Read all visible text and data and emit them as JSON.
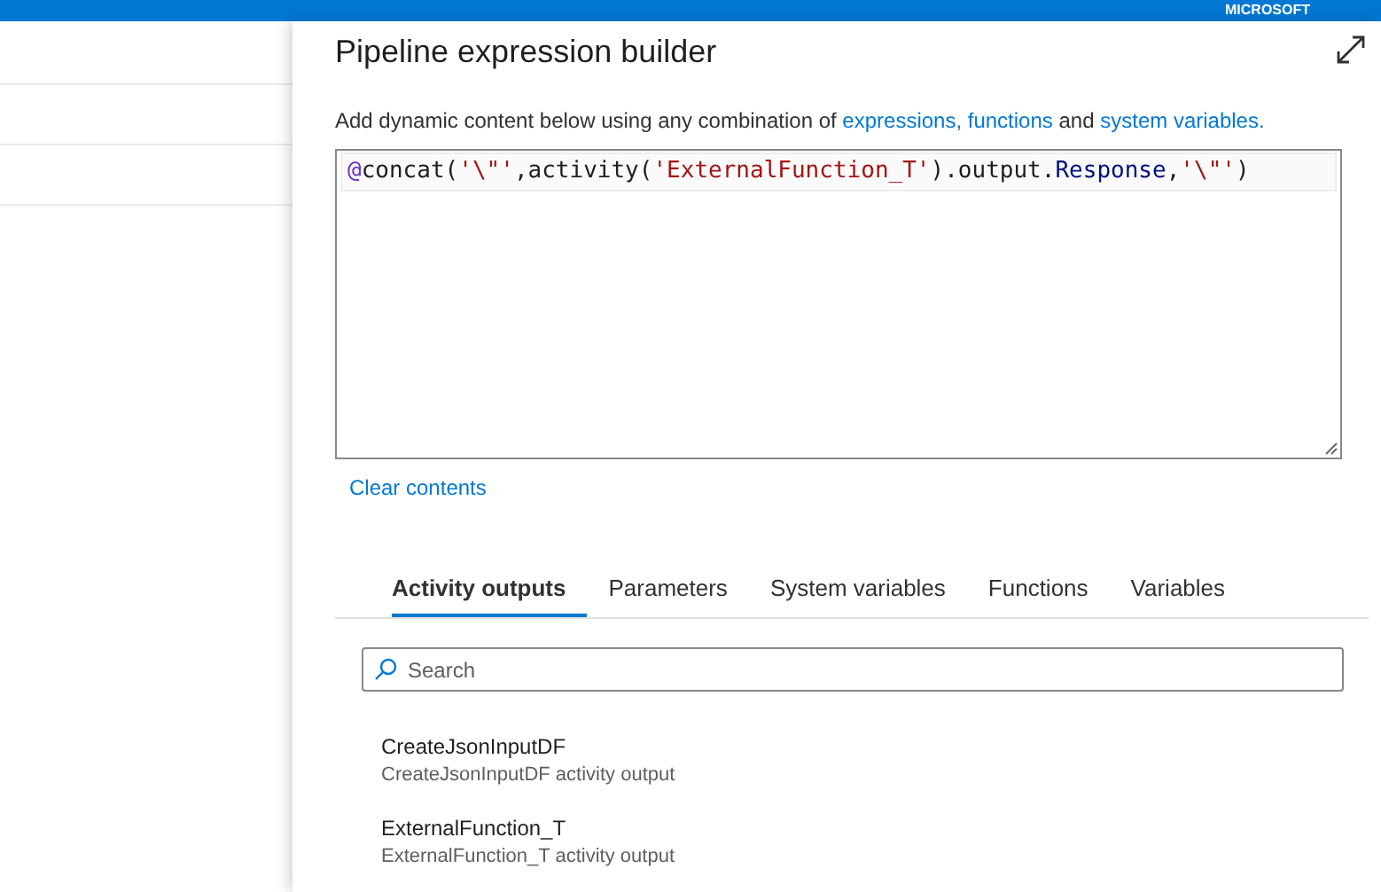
{
  "top_bar": {
    "brand": "MICROSOFT"
  },
  "panel": {
    "title": "Pipeline expression builder",
    "description": [
      {
        "kind": "text",
        "text": "Add dynamic content below using any combination of "
      },
      {
        "kind": "link",
        "text": "expressions, functions"
      },
      {
        "kind": "text",
        "text": " and "
      },
      {
        "kind": "link",
        "text": "system variables."
      }
    ],
    "expression": [
      {
        "kind": "at",
        "text": "@"
      },
      {
        "kind": "code",
        "text": "concat("
      },
      {
        "kind": "string",
        "text": "'\\\"'"
      },
      {
        "kind": "code",
        "text": ",activity("
      },
      {
        "kind": "string",
        "text": "'ExternalFunction_T'"
      },
      {
        "kind": "code",
        "text": ").output."
      },
      {
        "kind": "prop",
        "text": "Response"
      },
      {
        "kind": "code",
        "text": ","
      },
      {
        "kind": "string",
        "text": "'\\\"'"
      },
      {
        "kind": "code",
        "text": ")"
      }
    ],
    "clear_link": "Clear contents",
    "tabs": [
      {
        "label": "Activity outputs",
        "selected": true
      },
      {
        "label": "Parameters",
        "selected": false
      },
      {
        "label": "System variables",
        "selected": false
      },
      {
        "label": "Functions",
        "selected": false
      },
      {
        "label": "Variables",
        "selected": false
      }
    ],
    "search": {
      "placeholder": "Search"
    },
    "items": [
      {
        "title": "CreateJsonInputDF",
        "subtitle": "CreateJsonInputDF activity output"
      },
      {
        "title": "ExternalFunction_T",
        "subtitle": "ExternalFunction_T activity output"
      }
    ]
  }
}
